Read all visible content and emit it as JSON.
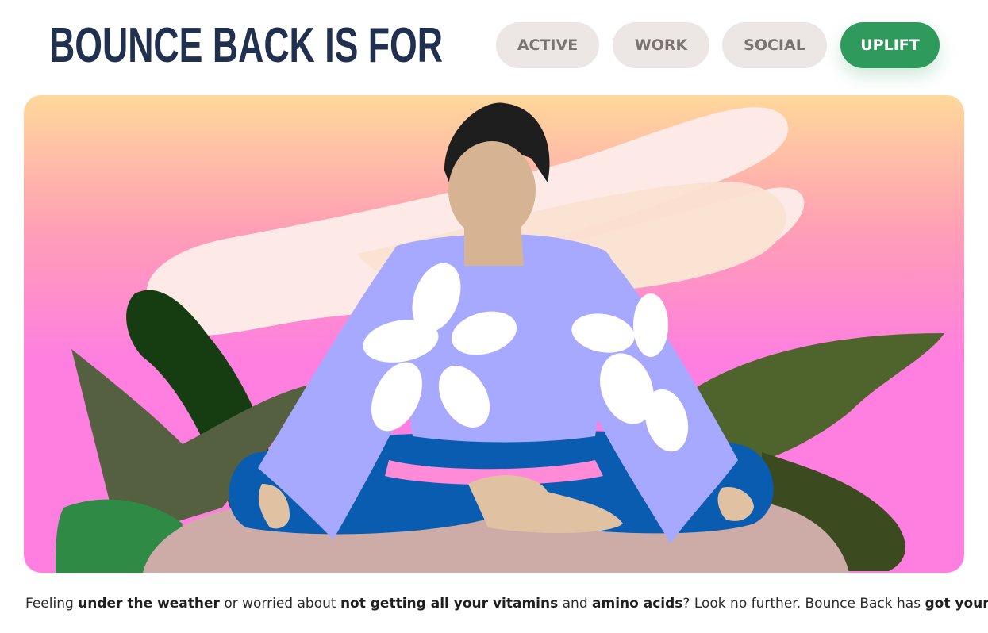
{
  "header": {
    "title": "BOUNCE BACK IS FOR"
  },
  "tabs": [
    {
      "label": "ACTIVE",
      "selected": false
    },
    {
      "label": "WORK",
      "selected": false
    },
    {
      "label": "SOCIAL",
      "selected": false
    },
    {
      "label": "UPLIFT",
      "selected": true
    }
  ],
  "colors": {
    "title": "#22304f",
    "tab_bg": "#ece7e4",
    "tab_text": "#7a7370",
    "tab_active_bg": "#2e9a5c",
    "tab_active_text": "#ffffff"
  },
  "hero": {
    "illustration": "meditating-person-illustration"
  },
  "caption": {
    "p1": "Feeling ",
    "b1": "under the weather",
    "p2": " or worried about ",
    "b2": "not getting all your vitamins",
    "p3": " and ",
    "b3": "amino acids",
    "p4": "? Look no further. Bounce Back has ",
    "b4": "got your back",
    "p5": "."
  }
}
